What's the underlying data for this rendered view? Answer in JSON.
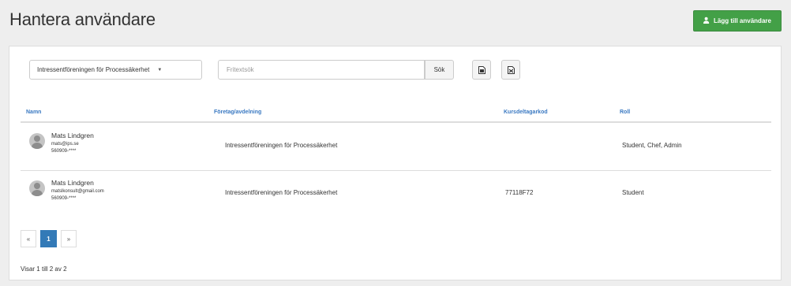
{
  "page": {
    "title": "Hantera användare",
    "add_user_label": "Lägg till användare",
    "add_user_icon": "user-plus-icon"
  },
  "filters": {
    "organization": "Intressentföreningen för Processäkerhet",
    "search_placeholder": "Fritextsök",
    "search_value": "",
    "search_button": "Sök",
    "export_icons": [
      "pdf-export-icon",
      "excel-export-icon"
    ]
  },
  "table": {
    "columns": [
      "Namn",
      "Företag/avdelning",
      "Kursdeltagarkod",
      "Roll"
    ],
    "rows": [
      {
        "name": "Mats Lindgren",
        "email": "mats@ips.se",
        "id_number": "560909-****",
        "company": "Intressentföreningen för Processäkerhet",
        "code": "",
        "role": "Student, Chef, Admin"
      },
      {
        "name": "Mats Lindgren",
        "email": "matslkonsult@gmail.com",
        "id_number": "560909-****",
        "company": "Intressentföreningen för Processäkerhet",
        "code": "77118F72",
        "role": "Student"
      }
    ]
  },
  "pagination": {
    "prev": "«",
    "current": "1",
    "next": "»",
    "summary": "Visar 1 till 2 av 2"
  },
  "colors": {
    "accent": "#337ab7",
    "success": "#43a047",
    "header_text": "#3a79c2"
  }
}
